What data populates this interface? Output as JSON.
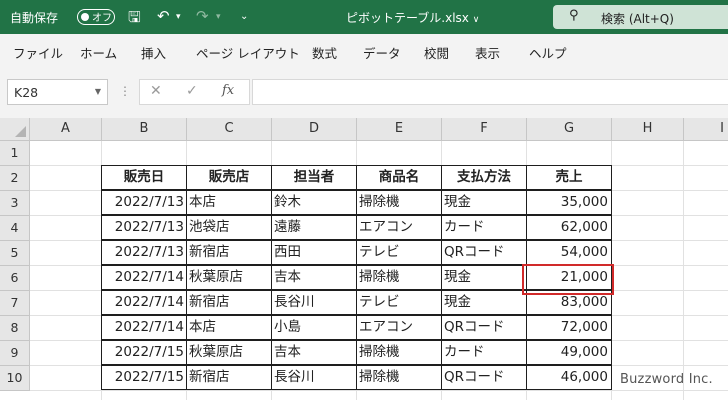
{
  "titlebar": {
    "autosave_label": "自動保存",
    "autosave_state": "オフ",
    "filename": "ピボットテーブル.xlsx",
    "search_placeholder": "検索 (Alt+Q)"
  },
  "ribbon": {
    "tabs": [
      "ファイル",
      "ホーム",
      "挿入",
      "ページ レイアウト",
      "数式",
      "データ",
      "校閲",
      "表示",
      "ヘルプ"
    ]
  },
  "formula_bar": {
    "name_box": "K28",
    "fx_label": "fx",
    "formula": ""
  },
  "columns": [
    "A",
    "B",
    "C",
    "D",
    "E",
    "F",
    "G",
    "H",
    "I"
  ],
  "rows": [
    "1",
    "2",
    "3",
    "4",
    "5",
    "6",
    "7",
    "8",
    "9",
    "10"
  ],
  "table": {
    "headers": [
      "販売日",
      "販売店",
      "担当者",
      "商品名",
      "支払方法",
      "売上"
    ],
    "data": [
      [
        "2022/7/13",
        "本店",
        "鈴木",
        "掃除機",
        "現金",
        "35,000"
      ],
      [
        "2022/7/13",
        "池袋店",
        "遠藤",
        "エアコン",
        "カード",
        "62,000"
      ],
      [
        "2022/7/13",
        "新宿店",
        "西田",
        "テレビ",
        "QRコード",
        "54,000"
      ],
      [
        "2022/7/14",
        "秋葉原店",
        "吉本",
        "掃除機",
        "現金",
        "21,000"
      ],
      [
        "2022/7/14",
        "新宿店",
        "長谷川",
        "テレビ",
        "現金",
        "83,000"
      ],
      [
        "2022/7/14",
        "本店",
        "小島",
        "エアコン",
        "QRコード",
        "72,000"
      ],
      [
        "2022/7/15",
        "秋葉原店",
        "吉本",
        "掃除機",
        "カード",
        "49,000"
      ],
      [
        "2022/7/15",
        "新宿店",
        "長谷川",
        "掃除機",
        "QRコード",
        "46,000"
      ]
    ]
  },
  "highlighted_cell": "G6",
  "watermark": "Buzzword Inc.",
  "colors": {
    "titlebar": "#217346",
    "highlight_border": "#d12a2a"
  }
}
